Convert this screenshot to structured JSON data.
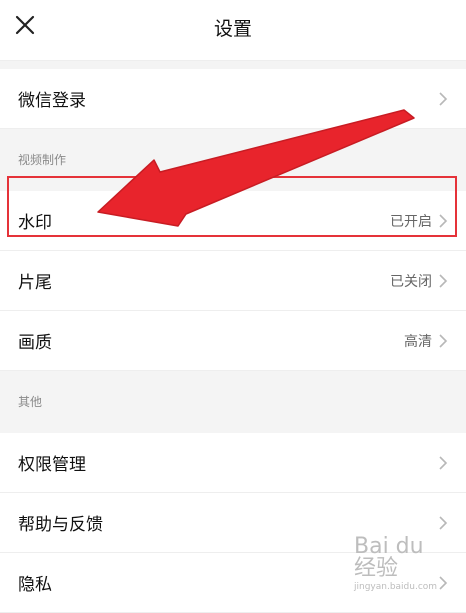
{
  "nav": {
    "title": "设置"
  },
  "rows": {
    "wechat_login": {
      "label": "微信登录"
    },
    "watermark": {
      "label": "水印",
      "value": "已开启"
    },
    "ending": {
      "label": "片尾",
      "value": "已关闭"
    },
    "quality": {
      "label": "画质",
      "value": "高清"
    },
    "permissions": {
      "label": "权限管理"
    },
    "help": {
      "label": "帮助与反馈"
    },
    "privacy": {
      "label": "隐私"
    }
  },
  "sections": {
    "video": "视频制作",
    "other": "其他"
  },
  "annotation": {
    "highlight_color": "#e53239"
  },
  "watermark_logo": {
    "top": "Bai du 经验",
    "bottom": "jingyan.baidu.com"
  }
}
